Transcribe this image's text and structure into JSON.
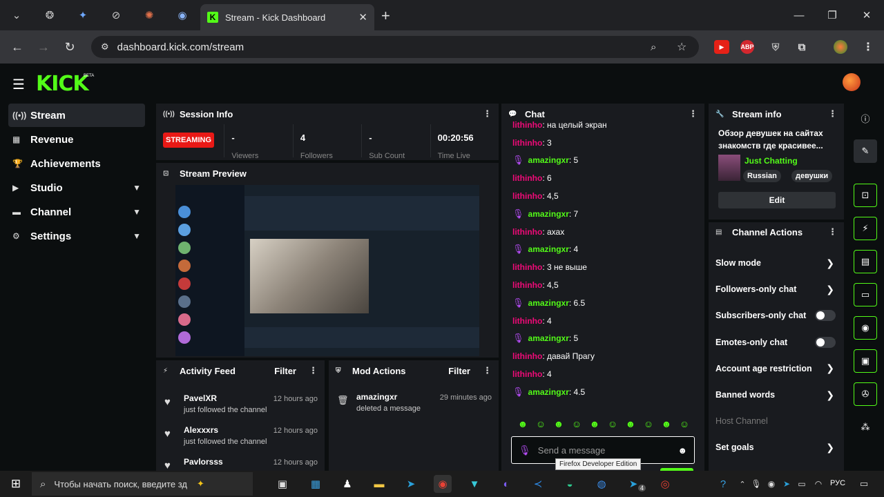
{
  "browser": {
    "active_tab_title": "Stream - Kick Dashboard",
    "new_tab": "+",
    "url": "dashboard.kick.com/stream",
    "ext_abp": "ABP"
  },
  "brand": {
    "logo": "KICK",
    "beta": "BETA"
  },
  "sidebar": {
    "items": [
      {
        "label": "Stream"
      },
      {
        "label": "Revenue"
      },
      {
        "label": "Achievements"
      },
      {
        "label": "Studio"
      },
      {
        "label": "Channel"
      },
      {
        "label": "Settings"
      }
    ]
  },
  "session": {
    "title": "Session Info",
    "status": "STREAMING",
    "viewers": "-",
    "followers": "4",
    "subs": "-",
    "time": "00:20:56",
    "viewers_label": "Viewers",
    "followers_label": "Followers",
    "subs_label": "Sub Count",
    "time_label": "Time Live"
  },
  "preview": {
    "title": "Stream Preview"
  },
  "activity": {
    "title": "Activity Feed",
    "filter": "Filter",
    "items": [
      {
        "name": "PavelXR",
        "action": "just followed the channel",
        "time": "12 hours ago"
      },
      {
        "name": "Alexxxrs",
        "action": "just followed the channel",
        "time": "12 hours ago"
      },
      {
        "name": "Pavlorsss",
        "action": "",
        "time": "12 hours ago"
      }
    ]
  },
  "mod": {
    "title": "Mod Actions",
    "filter": "Filter",
    "items": [
      {
        "name": "amazingxr",
        "action": "deleted a message",
        "time": "29 minutes ago"
      }
    ]
  },
  "chat": {
    "title": "Chat",
    "messages": [
      {
        "user": "lithinho",
        "text": ": на целый экран",
        "mod": false
      },
      {
        "user": "lithinho",
        "text": ": 3",
        "mod": false
      },
      {
        "user": "amazingxr",
        "text": ": 5",
        "mod": true
      },
      {
        "user": "lithinho",
        "text": ": 6",
        "mod": false
      },
      {
        "user": "lithinho",
        "text": ": 4,5",
        "mod": false
      },
      {
        "user": "amazingxr",
        "text": ": 7",
        "mod": true
      },
      {
        "user": "lithinho",
        "text": ": ахах",
        "mod": false
      },
      {
        "user": "amazingxr",
        "text": ": 4",
        "mod": true
      },
      {
        "user": "lithinho",
        "text": ": 3 не выше",
        "mod": false
      },
      {
        "user": "lithinho",
        "text": ": 4,5",
        "mod": false
      },
      {
        "user": "amazingxr",
        "text": ": 6.5",
        "mod": true
      },
      {
        "user": "lithinho",
        "text": ": 4",
        "mod": false
      },
      {
        "user": "amazingxr",
        "text": ": 5",
        "mod": true
      },
      {
        "user": "lithinho",
        "text": ": давай Прагу",
        "mod": false
      },
      {
        "user": "lithinho",
        "text": ": 4",
        "mod": false
      },
      {
        "user": "amazingxr",
        "text": ": 4.5",
        "mod": true
      }
    ],
    "placeholder": "Send a message",
    "tooltip": "Firefox Developer Edition"
  },
  "stream_info": {
    "title": "Stream info",
    "stream_title": "Обзор девушек на сайтах знакомств где красивее...",
    "category": "Just Chatting",
    "tags": [
      "Russian",
      "девушки"
    ],
    "edit": "Edit"
  },
  "channel_actions": {
    "title": "Channel Actions",
    "items": [
      {
        "label": "Slow mode",
        "kind": "arrow"
      },
      {
        "label": "Followers-only chat",
        "kind": "arrow"
      },
      {
        "label": "Subscribers-only chat",
        "kind": "toggle"
      },
      {
        "label": "Emotes-only chat",
        "kind": "toggle"
      },
      {
        "label": "Account age restriction",
        "kind": "arrow"
      },
      {
        "label": "Banned words",
        "kind": "arrow"
      },
      {
        "label": "Host Channel",
        "kind": "disabled"
      },
      {
        "label": "Set goals",
        "kind": "arrow"
      }
    ]
  },
  "taskbar": {
    "search": "Чтобы начать поиск, введите зд",
    "lang": "РУС",
    "tg_badge": "4"
  }
}
